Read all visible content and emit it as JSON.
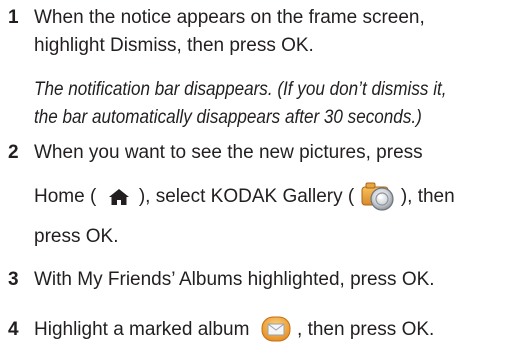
{
  "steps": [
    {
      "number": "1",
      "lines": [
        "When the notice appears on the frame screen,",
        "highlight Dismiss, then press OK."
      ],
      "note_lines": [
        "The notification bar disappears. (If you don’t dismiss it,",
        "the bar automatically disappears after 30 seconds.)"
      ]
    },
    {
      "number": "2",
      "line1": "When you want to see the new pictures, press",
      "line2_a": "Home (",
      "line2_b": "), select KODAK Gallery (",
      "line2_c": "), then",
      "line3": "press OK.",
      "icons": [
        "home-icon",
        "kodak-gallery-icon"
      ]
    },
    {
      "number": "3",
      "text": "With My Friends’ Albums highlighted, press OK."
    },
    {
      "number": "4",
      "text_a": "Highlight a marked album",
      "text_b": ", then press OK.",
      "icons": [
        "marked-album-icon"
      ]
    }
  ]
}
